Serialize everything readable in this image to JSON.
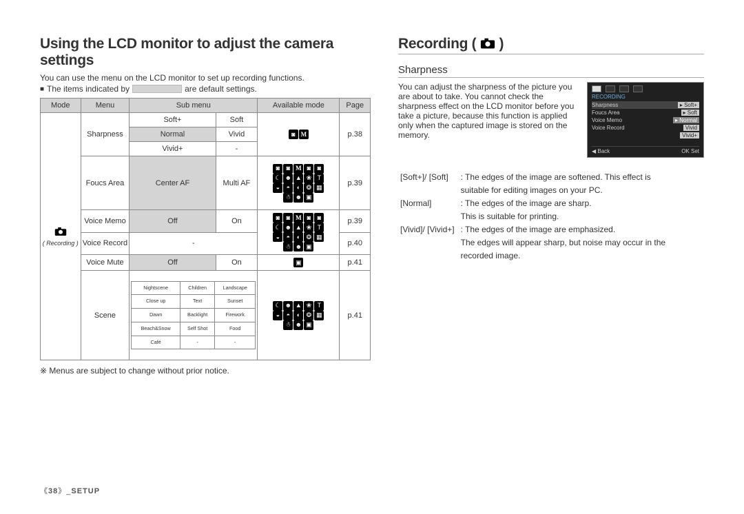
{
  "footer": {
    "page_prefix": "《",
    "page_no": "38",
    "page_suffix": "》_",
    "section": "SETUP"
  },
  "left": {
    "title": "Using the LCD monitor to adjust the camera settings",
    "intro": "You can use the menu on the LCD monitor to set up recording functions.",
    "default_prefix": "The items indicated by",
    "default_suffix": "are default settings.",
    "note": "※ Menus are subject to change without prior notice.",
    "mode_label": "( Recording )",
    "headers": {
      "mode": "Mode",
      "menu": "Menu",
      "sub": "Sub menu",
      "avail": "Available mode",
      "page": "Page"
    },
    "rows": {
      "sharpness": {
        "menu": "Sharpness",
        "r1a": "Soft+",
        "r1b": "Soft",
        "r2a": "Normal",
        "r2b": "Vivid",
        "r3a": "Vivid+",
        "r3b": "-",
        "page": "p.38"
      },
      "focus": {
        "menu": "Foucs Area",
        "a": "Center AF",
        "b": "Multi AF",
        "page": "p.39"
      },
      "vmemo": {
        "menu": "Voice Memo",
        "a": "Off",
        "b": "On",
        "page": "p.39"
      },
      "vrecord": {
        "menu": "Voice Record",
        "sub": "-",
        "page": "p.40"
      },
      "vmute": {
        "menu": "Voice Mute",
        "a": "Off",
        "b": "On",
        "page": "p.41"
      },
      "scene": {
        "menu": "Scene",
        "page": "p.41",
        "grid": [
          [
            "Nightscene",
            "Children",
            "Landscape"
          ],
          [
            "Close up",
            "Text",
            "Sunset"
          ],
          [
            "Dawn",
            "Backlight",
            "Firework"
          ],
          [
            "Beach&Snow",
            "Self Shot",
            "Food"
          ],
          [
            "Café",
            "-",
            "-"
          ]
        ]
      }
    }
  },
  "right": {
    "title": "Recording (",
    "title_tail": " )",
    "sub": "Sharpness",
    "para": "You can adjust the sharpness of the picture you are about to take. You cannot check the sharpness effect on the LCD monitor before you take a picture, because this function is applied only when the captured image is stored on the memory.",
    "device": {
      "hdr": "RECORDING",
      "row1": {
        "k": "Sharpness",
        "v": "Soft+"
      },
      "row2": {
        "k": "Foucs Area",
        "v": "Soft"
      },
      "row3": {
        "k": "Voice Memo",
        "v": "Normal"
      },
      "row4": {
        "k": "Voice Record",
        "v": "Vivid"
      },
      "row5": {
        "k": "",
        "v": "Vivid+"
      },
      "back": "◀  Back",
      "set": "OK  Set"
    },
    "defs": {
      "k1": "[Soft+]/ [Soft]",
      "v1a": ": The edges of the image are softened. This effect is",
      "v1b": "suitable for editing images on your PC.",
      "k2": "[Normal]",
      "v2a": ": The edges of the image are sharp.",
      "v2b": "This is suitable for printing.",
      "k3": "[Vivid]/ [Vivid+]",
      "v3a": ": The edges of the image are emphasized.",
      "v3b": "The edges will appear sharp, but noise may occur in the",
      "v3c": "recorded image."
    }
  }
}
